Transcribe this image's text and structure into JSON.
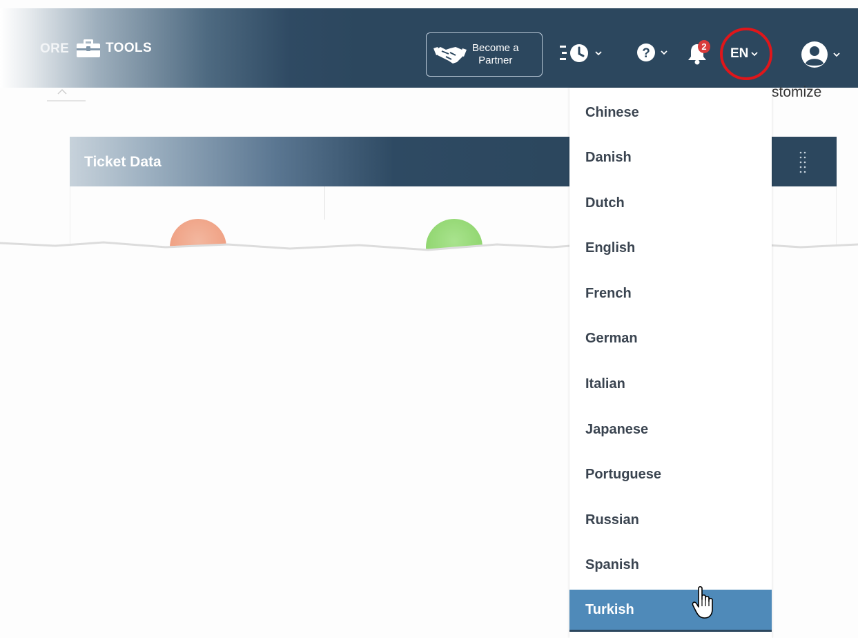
{
  "topbar": {
    "more_label": "ORE",
    "tools_label": "TOOLS",
    "partner_line1": "Become a",
    "partner_line2": "Partner",
    "notification_count": "2",
    "language_code": "EN"
  },
  "dashboard": {
    "customize_label": "stomize",
    "panel_title": "Ticket Data"
  },
  "language_menu": {
    "items": [
      "Chinese",
      "Danish",
      "Dutch",
      "English",
      "French",
      "German",
      "Italian",
      "Japanese",
      "Portuguese",
      "Russian",
      "Spanish",
      "Turkish"
    ],
    "hovered": "Turkish"
  },
  "colors": {
    "topbar": "#2c475e",
    "menu_highlight": "#4f8ab9",
    "annotation_circle": "#e0161a",
    "badge": "#d93b3b"
  },
  "icons": [
    "briefcase-icon",
    "handshake-icon",
    "history-clock-icon",
    "help-icon",
    "bell-icon",
    "user-avatar-icon",
    "chevron-down-icon",
    "drag-handle-icon",
    "hand-pointer-cursor"
  ]
}
